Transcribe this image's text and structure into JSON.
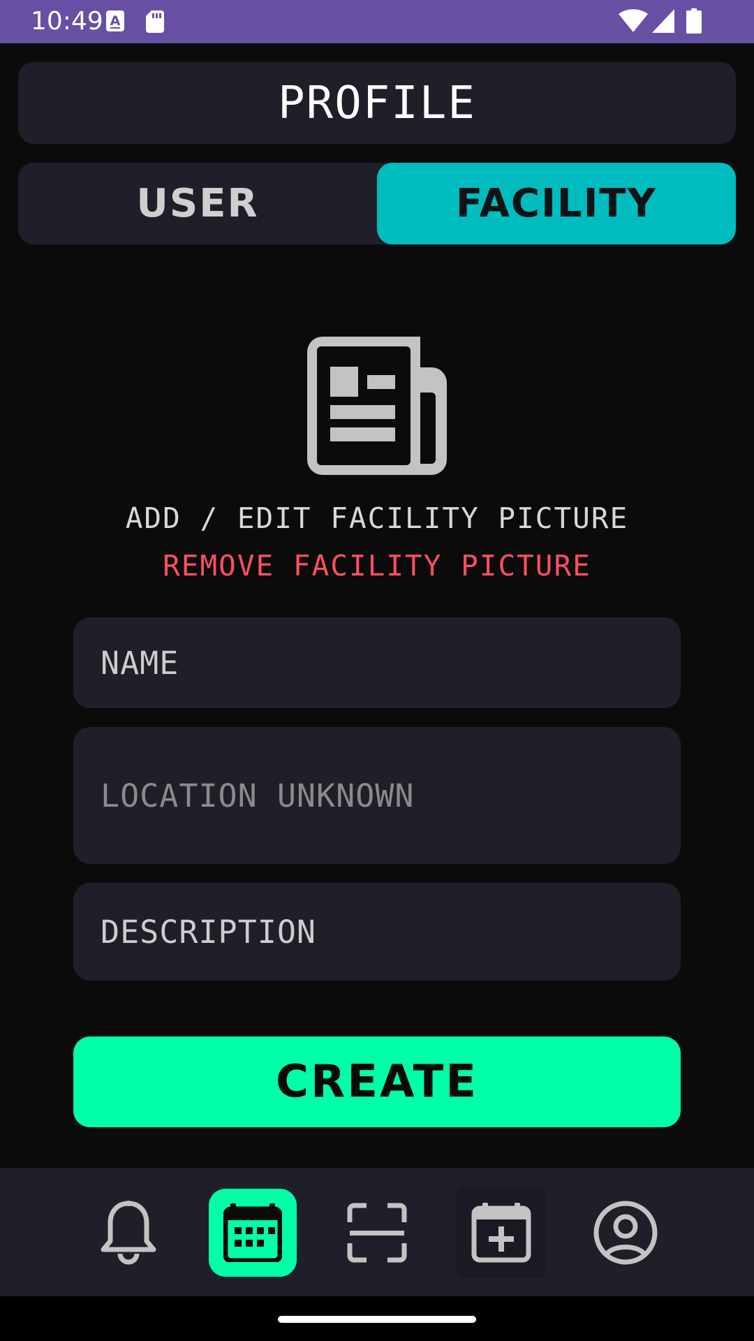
{
  "status_bar": {
    "time": "10:49",
    "icons": [
      "keyboard-a-icon",
      "sd-card-icon",
      "wifi-icon",
      "signal-icon",
      "battery-icon"
    ]
  },
  "header": {
    "title": "PROFILE"
  },
  "toggle": {
    "user_label": "USER",
    "facility_label": "FACILITY",
    "selected": "FACILITY"
  },
  "picture": {
    "icon": "newspaper-icon",
    "add_edit_label": "ADD / EDIT FACILITY PICTURE",
    "remove_label": "REMOVE FACILITY PICTURE"
  },
  "form": {
    "name_placeholder": "NAME",
    "location_text": "LOCATION UNKNOWN",
    "description_placeholder": "DESCRIPTION"
  },
  "create_button_label": "CREATE",
  "nav": {
    "items": [
      {
        "icon": "bell-icon"
      },
      {
        "icon": "calendar-grid-icon",
        "active": true
      },
      {
        "icon": "scan-icon"
      },
      {
        "icon": "calendar-add-icon"
      },
      {
        "icon": "profile-icon"
      }
    ]
  },
  "colors": {
    "status_bar": "#6750a4",
    "background": "#0b0b0b",
    "surface": "#1e1f29",
    "toggle_active": "#00bcbf",
    "accent": "#00ffa6",
    "danger": "#ff4f62"
  }
}
